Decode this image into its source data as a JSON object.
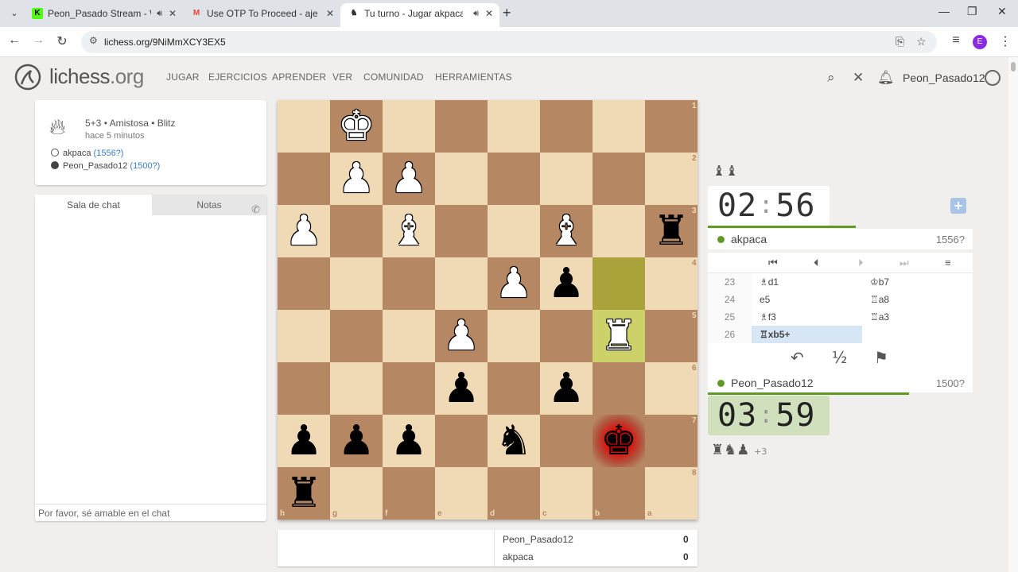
{
  "browser": {
    "tabs": [
      {
        "title": "Peon_Pasado Stream - Wat",
        "favicon": "K",
        "favicon_color": "#53fc18",
        "sound": true
      },
      {
        "title": "Use OTP To Proceed - ajedrez.e",
        "favicon": "M",
        "favicon_color": "#ea4335",
        "sound": false
      },
      {
        "title": "Tu turno - Jugar akpaca • li",
        "favicon": "♞",
        "favicon_color": "#333333",
        "sound": true
      }
    ],
    "url": "lichess.org/9NiMmXCY3EX5",
    "profile_initial": "E"
  },
  "header": {
    "brand": "lichess",
    "brand_tld": ".org",
    "menu": [
      "JUGAR",
      "EJERCICIOS",
      "APRENDER",
      "VER",
      "COMUNIDAD",
      "HERRAMIENTAS"
    ],
    "username": "Peon_Pasado12"
  },
  "game_info": {
    "setup": "5+3 • Amistosa • Blitz",
    "time_ago": "hace 5 minutos",
    "white_player": "akpaca",
    "white_rating": "(1556?)",
    "black_player": "Peon_Pasado12",
    "black_rating": "(1500?)"
  },
  "chat": {
    "tab_chat": "Sala de chat",
    "tab_notes": "Notas",
    "placeholder": "Por favor, sé amable en el chat"
  },
  "board": {
    "orientation": "black",
    "files": [
      "h",
      "g",
      "f",
      "e",
      "d",
      "c",
      "b",
      "a"
    ],
    "ranks": [
      "1",
      "2",
      "3",
      "4",
      "5",
      "6",
      "7",
      "8"
    ],
    "last_move": [
      "b4",
      "b5"
    ],
    "check_square": "b7",
    "pieces": [
      {
        "sq": "g1",
        "type": "king",
        "color": "white"
      },
      {
        "sq": "g2",
        "type": "pawn",
        "color": "white"
      },
      {
        "sq": "f2",
        "type": "pawn",
        "color": "white"
      },
      {
        "sq": "h3",
        "type": "pawn",
        "color": "white"
      },
      {
        "sq": "f3",
        "type": "bishop",
        "color": "white"
      },
      {
        "sq": "c3",
        "type": "bishop",
        "color": "white"
      },
      {
        "sq": "a3",
        "type": "rook",
        "color": "black"
      },
      {
        "sq": "d4",
        "type": "pawn",
        "color": "white"
      },
      {
        "sq": "c4",
        "type": "pawn",
        "color": "black"
      },
      {
        "sq": "e5",
        "type": "pawn",
        "color": "white"
      },
      {
        "sq": "b5",
        "type": "rook",
        "color": "white"
      },
      {
        "sq": "e6",
        "type": "pawn",
        "color": "black"
      },
      {
        "sq": "c6",
        "type": "pawn",
        "color": "black"
      },
      {
        "sq": "h7",
        "type": "pawn",
        "color": "black"
      },
      {
        "sq": "g7",
        "type": "pawn",
        "color": "black"
      },
      {
        "sq": "f7",
        "type": "pawn",
        "color": "black"
      },
      {
        "sq": "d7",
        "type": "knight",
        "color": "black"
      },
      {
        "sq": "b7",
        "type": "king",
        "color": "black"
      },
      {
        "sq": "h8",
        "type": "rook",
        "color": "black"
      }
    ]
  },
  "opponent": {
    "captured": "♝♝",
    "clock_min": "02",
    "clock_sec": "56",
    "name": "akpaca",
    "rating": "1556?",
    "time_fraction": 0.56
  },
  "me": {
    "captured": "♜♞♟",
    "material_diff": "+3",
    "clock_min": "03",
    "clock_sec": "59",
    "name": "Peon_Pasado12",
    "rating": "1500?",
    "time_fraction": 0.76
  },
  "moves": [
    {
      "num": "23",
      "white": "♗d1",
      "black": "♔b7"
    },
    {
      "num": "24",
      "white": "e5",
      "black": "♖a8"
    },
    {
      "num": "25",
      "white": "♗f3",
      "black": "♖a3"
    },
    {
      "num": "26",
      "white": "♖xb5+",
      "black": ""
    }
  ],
  "controls": {
    "takeback": "↶",
    "draw": "½",
    "resign": "⚑"
  },
  "crosstable": {
    "rows": [
      {
        "name": "Peon_Pasado12",
        "score": "0"
      },
      {
        "name": "akpaca",
        "score": "0"
      }
    ]
  },
  "colors": {
    "light_square": "#f0d9b5",
    "dark_square": "#b58863",
    "accent_green": "#629924"
  }
}
